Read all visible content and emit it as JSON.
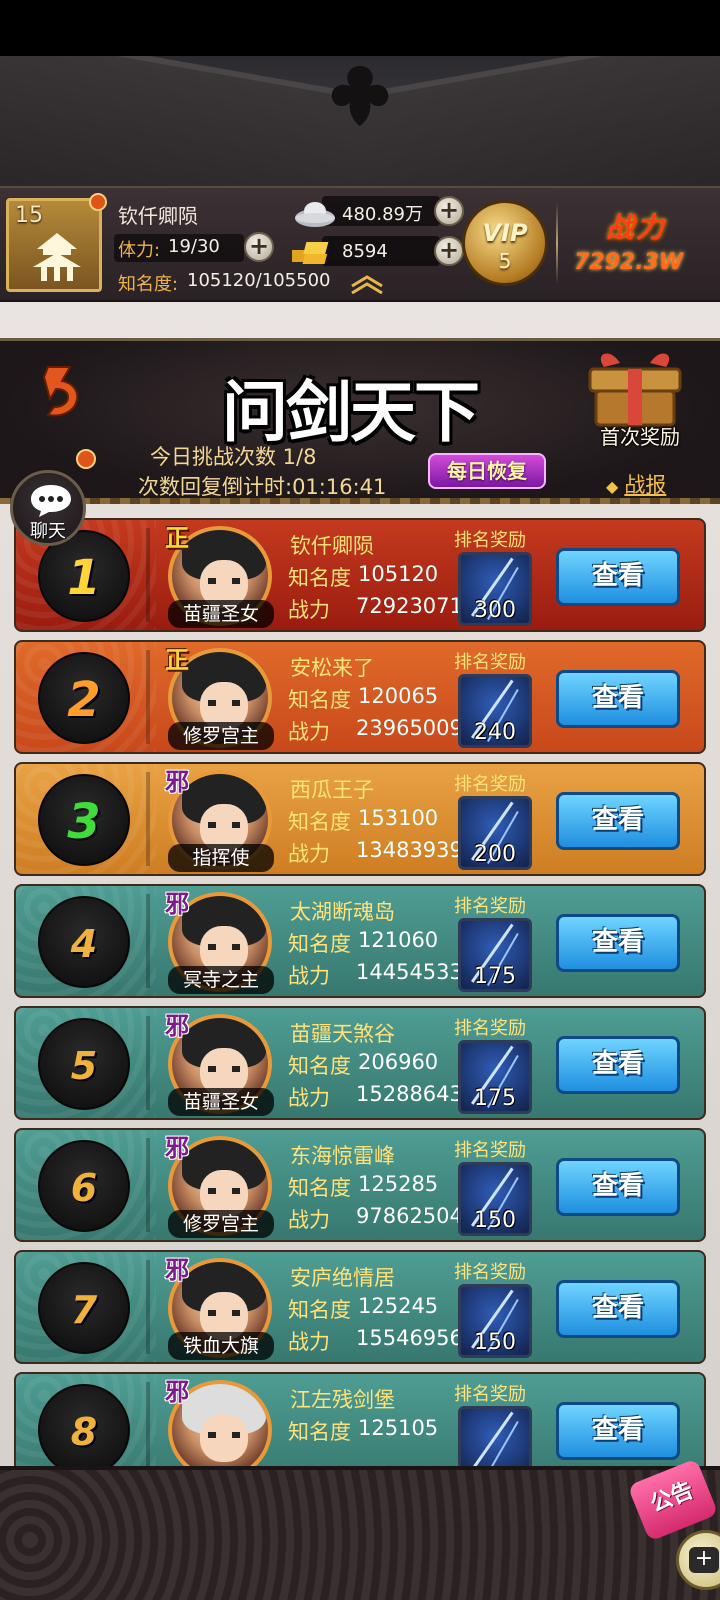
{
  "player": {
    "level": "15",
    "name": "钦仟卿陨",
    "stamina_label": "体力:",
    "stamina_value": "19/30",
    "fame_label": "知名度:",
    "fame_value": "105120/105500",
    "silver": "480.89万",
    "gold": "8594",
    "vip_label": "VIP",
    "vip_level": "5",
    "power_label": "战力",
    "power_value": "7292.3W"
  },
  "banner": {
    "title": "问剑天下",
    "challenge_text": "今日挑战次数 1/8",
    "countdown_text": "次数回复倒计时:01:16:41",
    "daily_button": "每日恢复",
    "first_reward": "首次奖励",
    "battle_report": "战报"
  },
  "chat": {
    "label": "聊天"
  },
  "list": {
    "reward_label": "排名奖励",
    "fame_label": "知名度",
    "power_label": "战力",
    "view_button": "查看",
    "rows": [
      {
        "rank": "1",
        "faction": "正",
        "character": "苗疆圣女",
        "name": "钦仟卿陨",
        "fame": "105120",
        "power": "72923071",
        "reward_qty": "300"
      },
      {
        "rank": "2",
        "faction": "正",
        "character": "修罗宫主",
        "name": "安松来了",
        "fame": "120065",
        "power": "239650097",
        "reward_qty": "240"
      },
      {
        "rank": "3",
        "faction": "邪",
        "character": "指挥使",
        "name": "西瓜王子",
        "fame": "153100",
        "power": "134839399",
        "reward_qty": "200"
      },
      {
        "rank": "4",
        "faction": "邪",
        "character": "冥寺之主",
        "name": "太湖断魂岛",
        "fame": "121060",
        "power": "144545337",
        "reward_qty": "175"
      },
      {
        "rank": "5",
        "faction": "邪",
        "character": "苗疆圣女",
        "name": "苗疆天煞谷",
        "fame": "206960",
        "power": "152886434",
        "reward_qty": "175"
      },
      {
        "rank": "6",
        "faction": "邪",
        "character": "修罗宫主",
        "name": "东海惊雷峰",
        "fame": "125285",
        "power": "97862504",
        "reward_qty": "150"
      },
      {
        "rank": "7",
        "faction": "邪",
        "character": "铁血大旗",
        "name": "安庐绝情居",
        "fame": "125245",
        "power": "155469565",
        "reward_qty": "150"
      },
      {
        "rank": "8",
        "faction": "邪",
        "character": "",
        "name": "江左残剑堡",
        "fame": "125105",
        "power": "",
        "reward_qty": ""
      }
    ]
  },
  "notice": {
    "label": "公告"
  },
  "colors": {
    "rank1": "#c43a1e",
    "rank2": "#e06a2a",
    "rank3": "#e8a244",
    "rank_other": "#4f9d93",
    "view_button": "#1f8fe0"
  }
}
